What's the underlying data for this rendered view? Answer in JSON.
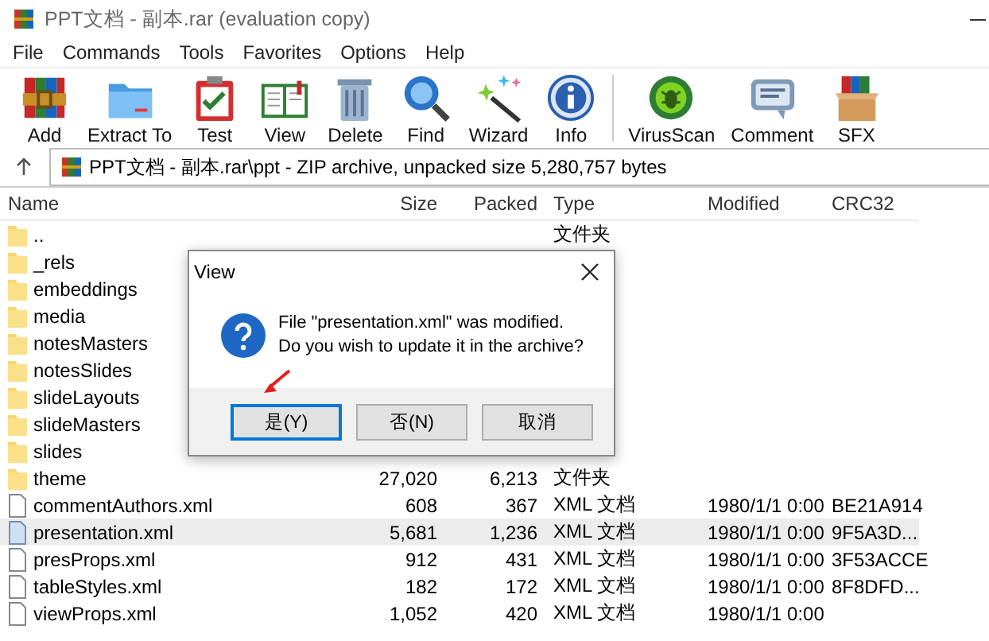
{
  "window": {
    "title": "PPT文档 - 副本.rar (evaluation copy)"
  },
  "menu": [
    "File",
    "Commands",
    "Tools",
    "Favorites",
    "Options",
    "Help"
  ],
  "toolbar": [
    {
      "label": "Add",
      "kind": "add"
    },
    {
      "label": "Extract To",
      "kind": "extract"
    },
    {
      "label": "Test",
      "kind": "test"
    },
    {
      "label": "View",
      "kind": "view"
    },
    {
      "label": "Delete",
      "kind": "delete"
    },
    {
      "label": "Find",
      "kind": "find"
    },
    {
      "label": "Wizard",
      "kind": "wizard"
    },
    {
      "label": "Info",
      "kind": "info"
    },
    {
      "kind": "separator"
    },
    {
      "label": "VirusScan",
      "kind": "virus"
    },
    {
      "label": "Comment",
      "kind": "comment"
    },
    {
      "label": "SFX",
      "kind": "sfx"
    }
  ],
  "address": {
    "path": "PPT文档 - 副本.rar\\ppt - ZIP archive, unpacked size 5,280,757 bytes"
  },
  "table": {
    "columns": [
      "Name",
      "Size",
      "Packed",
      "Type",
      "Modified",
      "CRC32"
    ],
    "rows": [
      {
        "kind": "folder",
        "selected": false,
        "name": "..",
        "type": "文件夹"
      },
      {
        "kind": "folder",
        "selected": false,
        "name": "_rels"
      },
      {
        "kind": "folder",
        "selected": false,
        "name": "embeddings"
      },
      {
        "kind": "folder",
        "selected": false,
        "name": "media"
      },
      {
        "kind": "folder",
        "selected": false,
        "name": "notesMasters"
      },
      {
        "kind": "folder",
        "selected": false,
        "name": "notesSlides"
      },
      {
        "kind": "folder",
        "selected": false,
        "name": "slideLayouts"
      },
      {
        "kind": "folder",
        "selected": false,
        "name": "slideMasters"
      },
      {
        "kind": "folder",
        "selected": false,
        "name": "slides"
      },
      {
        "kind": "folder",
        "selected": false,
        "name": "theme",
        "size": "27,020",
        "packed": "6,213",
        "type": "文件夹"
      },
      {
        "kind": "file",
        "selected": false,
        "name": "commentAuthors.xml",
        "size": "608",
        "packed": "367",
        "type": "XML 文档",
        "modified": "1980/1/1 0:00",
        "crc32": "BE21A914"
      },
      {
        "kind": "file",
        "selected": true,
        "name": "presentation.xml",
        "size": "5,681",
        "packed": "1,236",
        "type": "XML 文档",
        "modified": "1980/1/1 0:00",
        "crc32": "9F5A3D..."
      },
      {
        "kind": "file",
        "selected": false,
        "name": "presProps.xml",
        "size": "912",
        "packed": "431",
        "type": "XML 文档",
        "modified": "1980/1/1 0:00",
        "crc32": "3F53ACCE"
      },
      {
        "kind": "file",
        "selected": false,
        "name": "tableStyles.xml",
        "size": "182",
        "packed": "172",
        "type": "XML 文档",
        "modified": "1980/1/1 0:00",
        "crc32": "8F8DFD..."
      },
      {
        "kind": "file",
        "selected": false,
        "name": "viewProps.xml",
        "size": "1,052",
        "packed": "420",
        "type": "XML 文档",
        "modified": "1980/1/1 0:00"
      }
    ]
  },
  "dialog": {
    "title": "View",
    "message": [
      "File \"presentation.xml\" was modified.",
      "Do you wish to update it in the archive?"
    ],
    "buttons": [
      {
        "label": "是(Y)",
        "selected": true
      },
      {
        "label": "否(N)",
        "selected": false
      },
      {
        "label": "取消",
        "selected": false
      }
    ]
  }
}
